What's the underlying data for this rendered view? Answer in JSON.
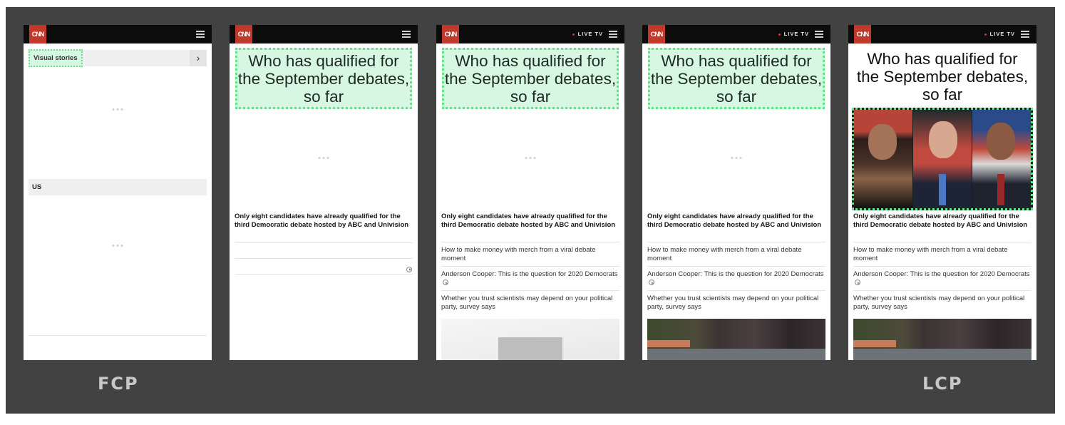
{
  "app": {
    "brand_logo": "CNN",
    "live_label": "LIVE TV"
  },
  "frames": [
    {
      "visual_stories": "Visual stories",
      "section_us": "US"
    },
    {
      "headline": "Who has qualified for the September debates, so far",
      "lead": "Only eight candidates have already qualified for the third Democratic debate hosted by ABC and Univision"
    },
    {
      "headline": "Who has qualified for the September debates, so far",
      "lead": "Only eight candidates have already qualified for the third Democratic debate hosted by ABC and Univision",
      "articles": [
        "How to make money with merch from a viral debate moment",
        "Anderson Cooper: This is the question for 2020 Democrats",
        "Whether you trust scientists may depend on your political party, survey says"
      ]
    },
    {
      "headline": "Who has qualified for the September debates, so far",
      "lead": "Only eight candidates have already qualified for the third Democratic debate hosted by ABC and Univision",
      "articles": [
        "How to make money with merch from a viral debate moment",
        "Anderson Cooper: This is the question for 2020 Democrats",
        "Whether you trust scientists may depend on your political party, survey says"
      ]
    },
    {
      "headline": "Who has qualified for the September debates, so far",
      "lead": "Only eight candidates have already qualified for the third Democratic debate hosted by ABC and Univision",
      "articles": [
        "How to make money with merch from a viral debate moment",
        "Anderson Cooper: This is the question for 2020 Democrats",
        "Whether you trust scientists may depend on your political party, survey says"
      ]
    }
  ],
  "labels": {
    "fcp": "FCP",
    "lcp": "LCP"
  },
  "colors": {
    "highlight_fill": "#d8f7e2",
    "highlight_border": "#62e38a",
    "cnn_red": "#c0392b"
  }
}
